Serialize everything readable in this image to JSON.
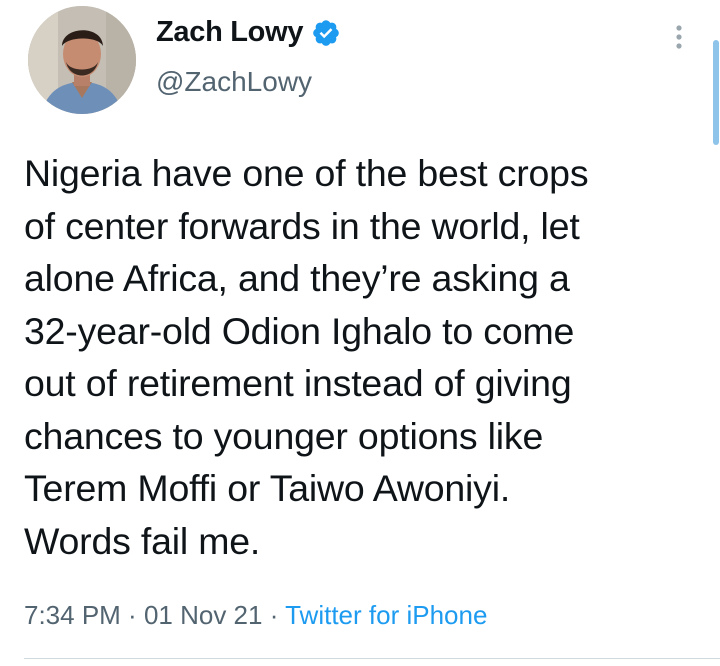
{
  "tweet": {
    "author": {
      "display_name": "Zach Lowy",
      "handle": "@ZachLowy",
      "verified": true,
      "avatar_icon": "profile-photo"
    },
    "text": "Nigeria have one of the best crops\nof center forwards in the world, let\nalone Africa, and they’re asking a\n32-year-old Odion Ighalo to come\nout of retirement instead of giving\nchances to younger options like\nTerem Moffi or Taiwo Awoniyi.\nWords fail me.",
    "time": "7:34 PM",
    "separator1": " · ",
    "date": "01 Nov 21",
    "separator2": " · ",
    "source": "Twitter for iPhone",
    "menu_icon": "more-vertical-icon"
  },
  "colors": {
    "text_primary": "#0f1419",
    "text_secondary": "#536471",
    "accent": "#1d9bf0",
    "divider": "#cfd9de"
  }
}
